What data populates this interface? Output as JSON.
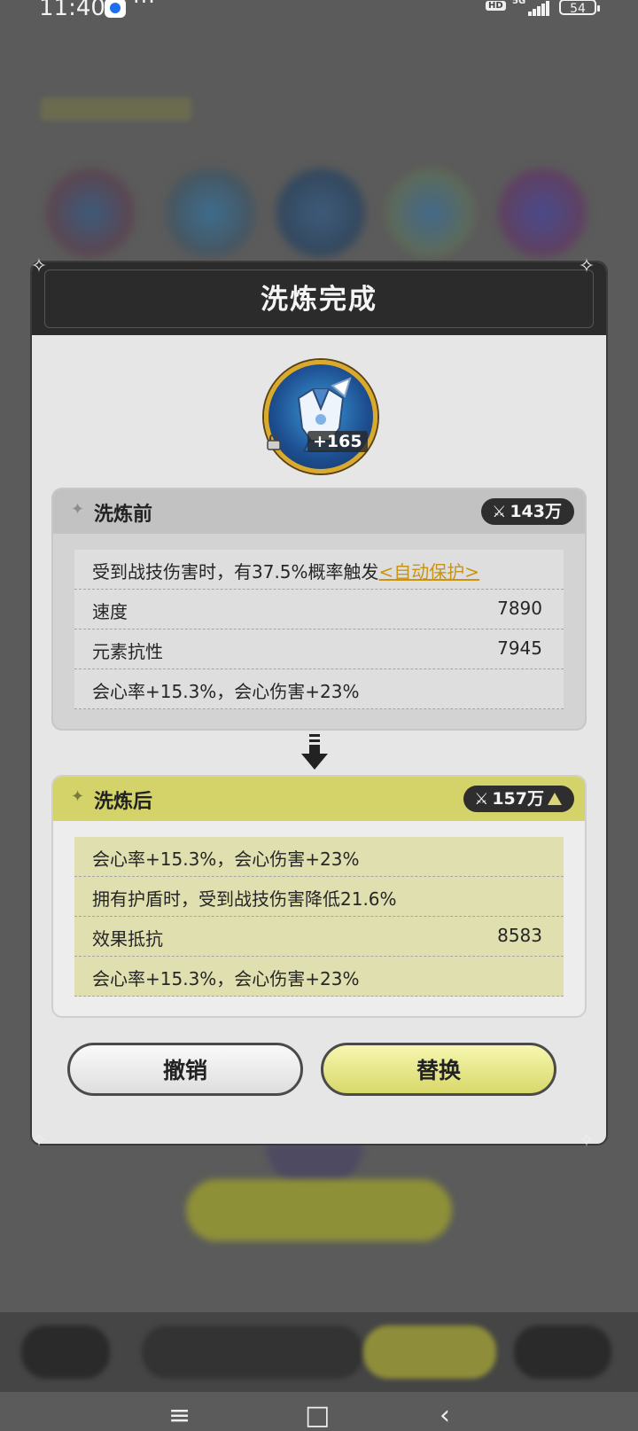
{
  "status_bar": {
    "time": "11:40",
    "more": "···",
    "hd": "HD",
    "network": "5G",
    "battery": "54"
  },
  "dialog": {
    "title": "洗炼完成",
    "equipment": {
      "level": "+165",
      "locked": true,
      "icon": "armor-icon"
    },
    "before": {
      "title": "洗炼前",
      "power": "143万",
      "rows": [
        {
          "label": "受到战技伤害时，有37.5%概率触发",
          "skill": "<自动保护>",
          "value": ""
        },
        {
          "label": "速度",
          "value": "7890"
        },
        {
          "label": "元素抗性",
          "value": "7945"
        },
        {
          "label": "会心率+15.3%，会心伤害+23%",
          "value": ""
        }
      ]
    },
    "after": {
      "title": "洗炼后",
      "power": "157万",
      "power_up": true,
      "rows": [
        {
          "label": "会心率+15.3%，会心伤害+23%",
          "value": ""
        },
        {
          "label": "拥有护盾时，受到战技伤害降低21.6%",
          "value": ""
        },
        {
          "label": "效果抵抗",
          "value": "8583"
        },
        {
          "label": "会心率+15.3%，会心伤害+23%",
          "value": ""
        }
      ]
    },
    "buttons": {
      "cancel": "撤销",
      "replace": "替换"
    }
  },
  "colors": {
    "accent_yellow": "#d4d36a",
    "skill_gold": "#c99412",
    "header_dark": "#2c2b2b"
  }
}
